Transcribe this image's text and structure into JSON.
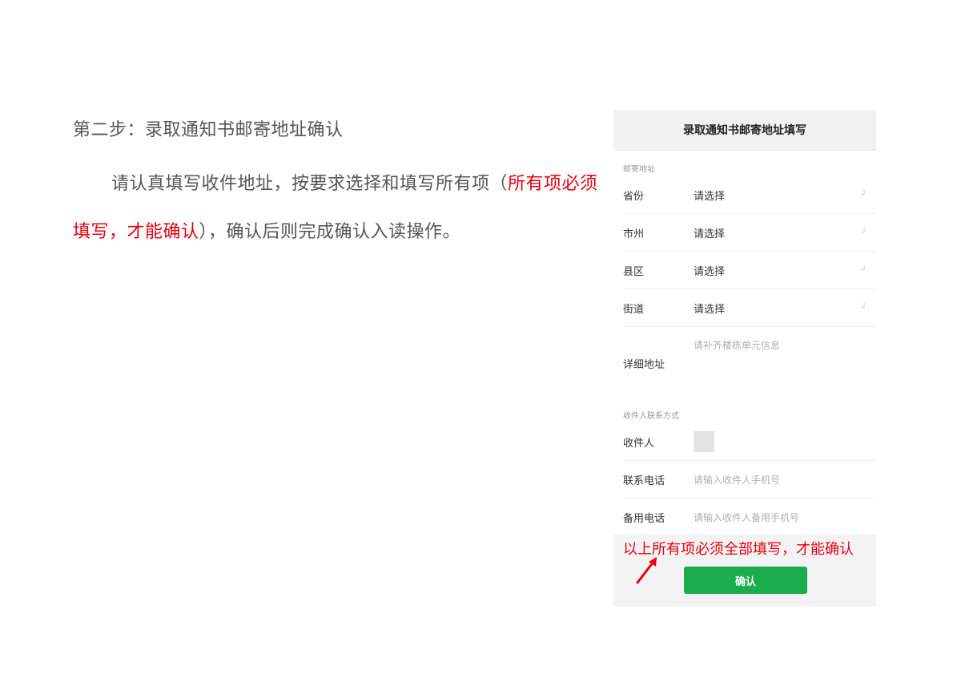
{
  "doc": {
    "step_title": "第二步：录取通知书邮寄地址确认",
    "instruction_part1": "请认真填写收件地址，按要求选择和填写所有项（",
    "instruction_highlight": "所有项必须填写，才能确认",
    "instruction_part2": "），确认后则完成确认入读操作。"
  },
  "phone": {
    "header_title": "录取通知书邮寄地址填写",
    "section_address": "邮寄地址",
    "fields": [
      {
        "label": "省份",
        "value": "请选择"
      },
      {
        "label": "市州",
        "value": "请选择"
      },
      {
        "label": "县区",
        "value": "请选择"
      },
      {
        "label": "街道",
        "value": "请选择"
      }
    ],
    "detail_label": "详细地址",
    "detail_placeholder": "请补齐楼栋单元信息",
    "section_contact": "收件人联系方式",
    "recipient_label": "收件人",
    "phone_label": "联系电话",
    "phone_placeholder": "请输入收件人手机号",
    "backup_label": "备用电话",
    "backup_placeholder": "请输入收件人备用手机号",
    "warning": "以上所有项必须全部填写，才能确认",
    "confirm_label": "确认"
  },
  "colors": {
    "highlight": "#e60012",
    "button": "#1aad4d"
  }
}
